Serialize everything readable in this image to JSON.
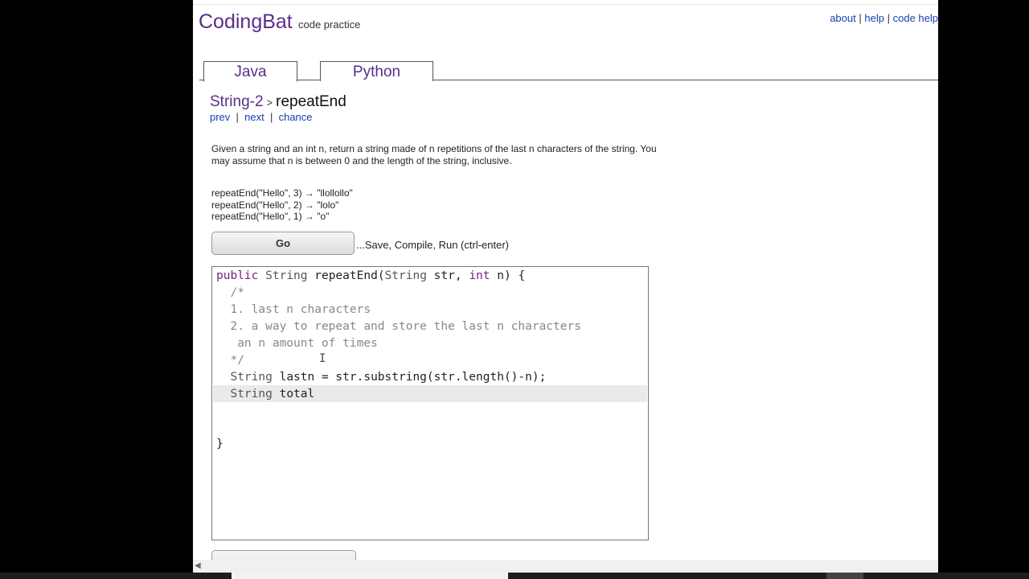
{
  "site": {
    "logo": "CodingBat",
    "tagline": "code practice"
  },
  "toplinks": {
    "about": "about",
    "sep1": "|",
    "help": "help",
    "sep2": "|",
    "code_help": "code help"
  },
  "tabs": [
    {
      "label": "Java"
    },
    {
      "label": "Python"
    }
  ],
  "breadcrumb": {
    "category": "String-2",
    "separator": ">",
    "problem": "repeatEnd"
  },
  "nav": {
    "prev": "prev",
    "next": "next",
    "chance": "chance",
    "sep": "|"
  },
  "description": "Given a string and an int n, return a string made of n repetitions of the last n characters of the string. You may assume that n is between 0 and the length of the string, inclusive.",
  "examples": [
    "repeatEnd(\"Hello\", 3) → \"llollollo\"",
    "repeatEnd(\"Hello\", 2) → \"lolo\"",
    "repeatEnd(\"Hello\", 1) → \"o\""
  ],
  "go_button": "Go",
  "go_hint": "...Save, Compile, Run (ctrl-enter)",
  "editor": {
    "lines": [
      "public String repeatEnd(String str, int n) {",
      "  /*",
      "  1. last n characters",
      "  2. a way to repeat and store the last n characters",
      "   an n amount of times",
      "  */",
      "  String lastn = str.substring(str.length()-n);",
      "  String total",
      "",
      "",
      "}"
    ]
  },
  "colors": {
    "logo": "#5b2d8a",
    "link": "#1a3ea8",
    "keyword": "#7a1f7a"
  }
}
